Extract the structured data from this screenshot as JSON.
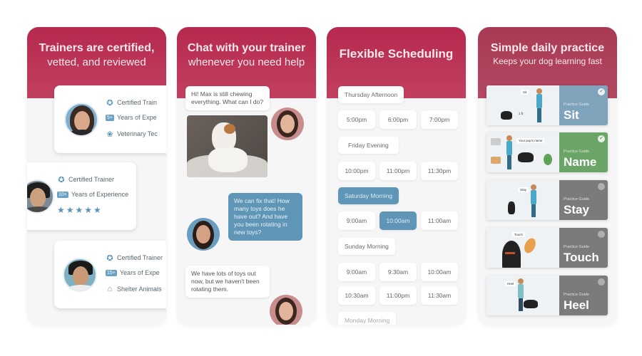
{
  "colors": {
    "header": "#b6294e",
    "accent_blue": "#5f95b6",
    "name_green": "#6aa467",
    "sit_blue": "#7fa3ba",
    "grey_card": "#7b7b7b"
  },
  "panels": [
    {
      "title_bold": "Trainers are certified,",
      "title_sub": "vetted, and reviewed",
      "trainers": [
        {
          "cert_icon": "ribbon-badge-icon",
          "cert": "Certified Train",
          "years_badge": "5+",
          "years": "Years of Expe",
          "extra_icon": "paw-icon",
          "extra": "Veterinary Tec"
        },
        {
          "cert_icon": "ribbon-badge-icon",
          "cert": "Certified Trainer",
          "years_badge": "10+",
          "years": "Years of Experience",
          "rating": "★★★★★"
        },
        {
          "cert_icon": "ribbon-badge-icon",
          "cert": "Certified Trainer",
          "years_badge": "15+",
          "years": "Years of Expe",
          "extra_icon": "shelter-icon",
          "extra": "Shelter Animals"
        }
      ]
    },
    {
      "title_bold": "Chat with your trainer",
      "title_sub": "whenever you need help",
      "messages": [
        {
          "from": "user",
          "text": "Hi! Max is still chewing everything. What can I do?"
        },
        {
          "from": "user",
          "photo": "dog-chewing-photo"
        },
        {
          "from": "trainer",
          "text": "We can fix that! How many toys does he have out? And have you been rotating in new toys?"
        },
        {
          "from": "user",
          "text": "We have lots of toys out now, but we haven't been rotating them."
        }
      ]
    },
    {
      "title_bold": "Flexible Scheduling",
      "days": [
        {
          "label": "Thursday Afternoon",
          "active": false,
          "slots": [
            "5:00pm",
            "6:00pm",
            "7:00pm"
          ]
        },
        {
          "label": "Friday Evening",
          "active": false,
          "slots": [
            "10:00pm",
            "11:00pm",
            "11:30pm"
          ]
        },
        {
          "label": "Saturday Morning",
          "active": true,
          "slots": [
            "9:00am",
            "10:00am",
            "11:00am"
          ],
          "selected_slot": "10:00am"
        },
        {
          "label": "Sunday Morning",
          "active": false,
          "slots": [
            "9:00am",
            "9:30am",
            "10:00am",
            "10:30am",
            "11:00pm",
            "11:30am"
          ]
        },
        {
          "label": "Monday Morning",
          "active": false
        }
      ]
    },
    {
      "title_bold": "Simple daily practice",
      "title_sub": "Keeps your dog learning fast",
      "guides": [
        {
          "caption": "Practice Guide",
          "name": "Sit",
          "completed": true,
          "bubble": "Sit",
          "distance": "1 ft"
        },
        {
          "caption": "Practice Guide",
          "name": "Name",
          "completed": true,
          "bubble": "Your pup's name"
        },
        {
          "caption": "Practice Guide",
          "name": "Stay",
          "completed": false,
          "bubble": "Stay"
        },
        {
          "caption": "Practice Guide",
          "name": "Touch",
          "completed": false,
          "bubble": "Touch"
        },
        {
          "caption": "Practice Guide",
          "name": "Heel",
          "completed": false,
          "bubble": "Heel"
        }
      ]
    }
  ]
}
